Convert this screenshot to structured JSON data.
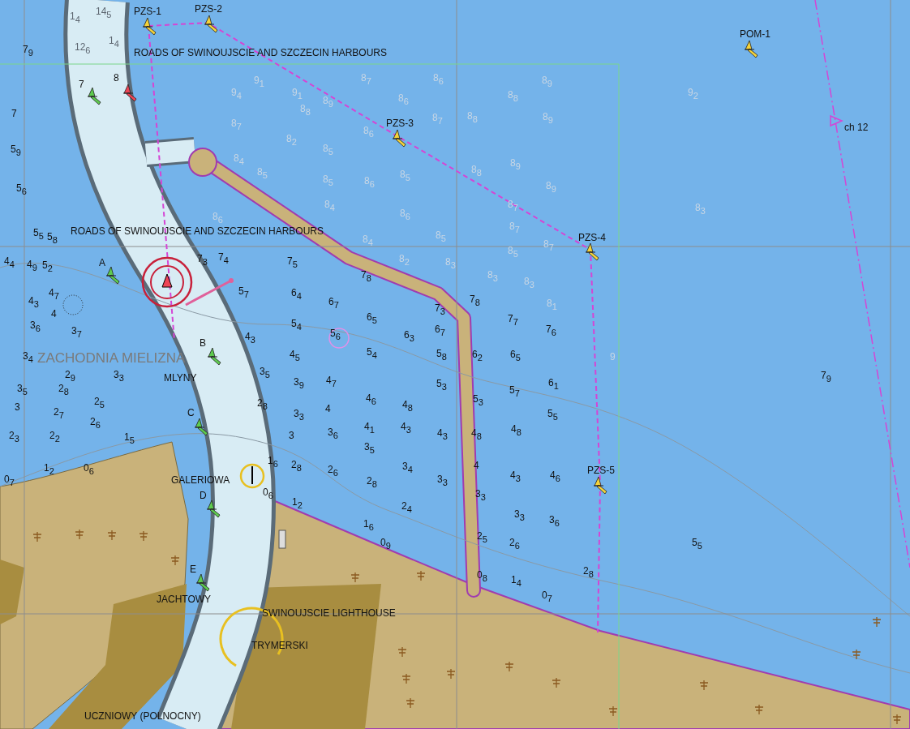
{
  "chart": {
    "area_labels": [
      {
        "text": "ROADS OF SWINOUJSCIE AND SZCZECIN HARBOURS",
        "kind": "zone"
      },
      {
        "text": "ROADS OF SWINOUJSCIE AND SZCZECIN HARBOURS",
        "kind": "zone"
      },
      {
        "text": "ZACHODNIA MIELIZNA",
        "kind": "shoal"
      },
      {
        "text": "MLYNY",
        "kind": "place"
      },
      {
        "text": "GALERIOWA",
        "kind": "place"
      },
      {
        "text": "JACHTOWY",
        "kind": "place"
      },
      {
        "text": "SWINOUJSCIE LIGHTHOUSE",
        "kind": "place"
      },
      {
        "text": "TRYMERSKI",
        "kind": "place"
      },
      {
        "text": "UCZNIOWY (POLNOCNY)",
        "kind": "place"
      },
      {
        "text": "ch 12",
        "kind": "place"
      }
    ],
    "buoys": [
      {
        "label": "PZS-1",
        "kind": "special"
      },
      {
        "label": "PZS-2",
        "kind": "special"
      },
      {
        "label": "POM-1",
        "kind": "special"
      },
      {
        "label": "PZS-3",
        "kind": "special"
      },
      {
        "label": "PZS-4",
        "kind": "special"
      },
      {
        "label": "PZS-5",
        "kind": "special"
      },
      {
        "label": "7",
        "kind": "starboard"
      },
      {
        "label": "8",
        "kind": "port"
      },
      {
        "label": "A",
        "kind": "starboard"
      },
      {
        "label": "B",
        "kind": "starboard"
      },
      {
        "label": "C",
        "kind": "starboard"
      },
      {
        "label": "D",
        "kind": "starboard"
      },
      {
        "label": "E",
        "kind": "starboard"
      }
    ],
    "soundings": [
      {
        "depth": "6$_{4}$",
        "kind": "shallow"
      },
      {
        "depth": "6$_{7}$",
        "kind": "shallow"
      },
      {
        "depth": "6$_{5}$",
        "kind": "shallow"
      },
      {
        "depth": "5$_{4}$",
        "kind": "shallow"
      },
      {
        "depth": "5$_{6}$",
        "kind": "shallow"
      },
      {
        "depth": "6$_{3}$",
        "kind": "shallow"
      },
      {
        "depth": "5$_{4}$",
        "kind": "shallow"
      },
      {
        "depth": "4$_{3}$",
        "kind": "shallow"
      },
      {
        "depth": "4$_{5}$",
        "kind": "shallow"
      },
      {
        "depth": "3$_{5}$",
        "kind": "shallow"
      },
      {
        "depth": "3$_{9}$",
        "kind": "shallow"
      },
      {
        "depth": "4$_{7}$",
        "kind": "shallow"
      },
      {
        "depth": "7$_{3}$",
        "kind": "shallow"
      },
      {
        "depth": "6$_{7}$",
        "kind": "shallow"
      },
      {
        "depth": "5$_{8}$",
        "kind": "shallow"
      },
      {
        "depth": "5$_{3}$",
        "kind": "shallow"
      },
      {
        "depth": "7$_{8}$",
        "kind": "shallow"
      },
      {
        "depth": "7$_{7}$",
        "kind": "shallow"
      },
      {
        "depth": "7$_{6}$",
        "kind": "shallow"
      },
      {
        "depth": "6$_{2}$",
        "kind": "shallow"
      },
      {
        "depth": "6$_{5}$",
        "kind": "shallow"
      },
      {
        "depth": "6$_{1}$",
        "kind": "shallow"
      },
      {
        "depth": "5$_{7}$",
        "kind": "shallow"
      },
      {
        "depth": "2$_{8}$",
        "kind": "shallow"
      },
      {
        "depth": "3$_{3}$",
        "kind": "shallow"
      },
      {
        "depth": "4",
        "kind": "shallow"
      },
      {
        "depth": "4$_{6}$",
        "kind": "shallow"
      },
      {
        "depth": "4$_{8}$",
        "kind": "shallow"
      },
      {
        "depth": "5$_{3}$",
        "kind": "shallow"
      },
      {
        "depth": "4$_{1}$",
        "kind": "shallow"
      },
      {
        "depth": "4$_{3}$",
        "kind": "shallow"
      },
      {
        "depth": "4$_{3}$",
        "kind": "shallow"
      },
      {
        "depth": "4$_{8}$",
        "kind": "shallow"
      },
      {
        "depth": "4$_{8}$",
        "kind": "shallow"
      },
      {
        "depth": "5$_{5}$",
        "kind": "shallow"
      },
      {
        "depth": "3",
        "kind": "shallow"
      },
      {
        "depth": "3$_{6}$",
        "kind": "shallow"
      },
      {
        "depth": "3$_{5}$",
        "kind": "shallow"
      },
      {
        "depth": "3$_{4}$",
        "kind": "shallow"
      },
      {
        "depth": "3$_{3}$",
        "kind": "shallow"
      },
      {
        "depth": "4",
        "kind": "shallow"
      },
      {
        "depth": "4$_{3}$",
        "kind": "shallow"
      },
      {
        "depth": "4$_{6}$",
        "kind": "shallow"
      },
      {
        "depth": "1$_{6}$",
        "kind": "shallow"
      },
      {
        "depth": "2$_{8}$",
        "kind": "shallow"
      },
      {
        "depth": "2$_{6}$",
        "kind": "shallow"
      },
      {
        "depth": "2$_{8}$",
        "kind": "shallow"
      },
      {
        "depth": "2$_{4}$",
        "kind": "shallow"
      },
      {
        "depth": "3$_{3}$",
        "kind": "shallow"
      },
      {
        "depth": "3$_{3}$",
        "kind": "shallow"
      },
      {
        "depth": "3$_{6}$",
        "kind": "shallow"
      },
      {
        "depth": "0$_{6}$",
        "kind": "shallow"
      },
      {
        "depth": "1$_{2}$",
        "kind": "shallow"
      },
      {
        "depth": "1$_{6}$",
        "kind": "shallow"
      },
      {
        "depth": "0$_{9}$",
        "kind": "shallow"
      },
      {
        "depth": "2$_{5}$",
        "kind": "shallow"
      },
      {
        "depth": "2$_{6}$",
        "kind": "shallow"
      },
      {
        "depth": "2$_{8}$",
        "kind": "shallow"
      },
      {
        "depth": "0$_{8}$",
        "kind": "shallow"
      },
      {
        "depth": "1$_{4}$",
        "kind": "shallow"
      },
      {
        "depth": "0$_{7}$",
        "kind": "shallow"
      },
      {
        "depth": "5$_{5}$",
        "kind": "shallow"
      },
      {
        "depth": "7$_{9}$",
        "kind": "shallow"
      },
      {
        "depth": "7$_{3}$",
        "kind": "shallow"
      },
      {
        "depth": "7$_{4}$",
        "kind": "shallow"
      },
      {
        "depth": "7$_{5}$",
        "kind": "shallow"
      },
      {
        "depth": "5$_{7}$",
        "kind": "shallow"
      },
      {
        "depth": "7$_{8}$",
        "kind": "shallow"
      },
      {
        "depth": "7$_{9}$",
        "kind": "shallow"
      },
      {
        "depth": "7",
        "kind": "shallow"
      },
      {
        "depth": "5$_{9}$",
        "kind": "shallow"
      },
      {
        "depth": "5$_{6}$",
        "kind": "shallow"
      },
      {
        "depth": "5$_{5}$",
        "kind": "shallow"
      },
      {
        "depth": "5$_{8}$",
        "kind": "shallow"
      },
      {
        "depth": "4$_{4}$",
        "kind": "shallow"
      },
      {
        "depth": "4$_{9}$",
        "kind": "shallow"
      },
      {
        "depth": "5$_{2}$",
        "kind": "shallow"
      },
      {
        "depth": "4$_{3}$",
        "kind": "shallow"
      },
      {
        "depth": "3$_{6}$",
        "kind": "shallow"
      },
      {
        "depth": "3$_{4}$",
        "kind": "shallow"
      },
      {
        "depth": "2$_{9}$",
        "kind": "shallow"
      },
      {
        "depth": "3$_{5}$",
        "kind": "shallow"
      },
      {
        "depth": "2$_{8}$",
        "kind": "shallow"
      },
      {
        "depth": "3",
        "kind": "shallow"
      },
      {
        "depth": "2$_{7}$",
        "kind": "shallow"
      },
      {
        "depth": "2$_{5}$",
        "kind": "shallow"
      },
      {
        "depth": "2$_{6}$",
        "kind": "shallow"
      },
      {
        "depth": "2$_{3}$",
        "kind": "shallow"
      },
      {
        "depth": "2$_{2}$",
        "kind": "shallow"
      },
      {
        "depth": "1$_{5}$",
        "kind": "shallow"
      },
      {
        "depth": "1$_{2}$",
        "kind": "shallow"
      },
      {
        "depth": "0$_{6}$",
        "kind": "shallow"
      },
      {
        "depth": "0$_{7}$",
        "kind": "shallow"
      },
      {
        "depth": "4$_{7}$",
        "kind": "shallow"
      },
      {
        "depth": "4",
        "kind": "shallow"
      },
      {
        "depth": "3$_{7}$",
        "kind": "shallow"
      },
      {
        "depth": "3$_{3}$",
        "kind": "shallow"
      },
      {
        "depth": "8$_{7}$",
        "kind": "deep"
      },
      {
        "depth": "8$_{6}$",
        "kind": "deep"
      },
      {
        "depth": "8$_{9}$",
        "kind": "deep"
      },
      {
        "depth": "8$_{6}$",
        "kind": "deep"
      },
      {
        "depth": "8$_{8}$",
        "kind": "deep"
      },
      {
        "depth": "8$_{7}$",
        "kind": "deep"
      },
      {
        "depth": "8$_{8}$",
        "kind": "deep"
      },
      {
        "depth": "8$_{9}$",
        "kind": "deep"
      },
      {
        "depth": "8$_{6}$",
        "kind": "deep"
      },
      {
        "depth": "8$_{5}$",
        "kind": "deep"
      },
      {
        "depth": "8$_{5}$",
        "kind": "deep"
      },
      {
        "depth": "8$_{5}$",
        "kind": "deep"
      },
      {
        "depth": "8$_{6}$",
        "kind": "deep"
      },
      {
        "depth": "8$_{8}$",
        "kind": "deep"
      },
      {
        "depth": "8$_{9}$",
        "kind": "deep"
      },
      {
        "depth": "8$_{9}$",
        "kind": "deep"
      },
      {
        "depth": "8$_{4}$",
        "kind": "deep"
      },
      {
        "depth": "8$_{6}$",
        "kind": "deep"
      },
      {
        "depth": "8$_{7}$",
        "kind": "deep"
      },
      {
        "depth": "8$_{4}$",
        "kind": "deep"
      },
      {
        "depth": "8$_{5}$",
        "kind": "deep"
      },
      {
        "depth": "8$_{7}$",
        "kind": "deep"
      },
      {
        "depth": "8$_{2}$",
        "kind": "deep"
      },
      {
        "depth": "8$_{3}$",
        "kind": "deep"
      },
      {
        "depth": "8$_{3}$",
        "kind": "deep"
      },
      {
        "depth": "8$_{3}$",
        "kind": "deep"
      },
      {
        "depth": "8$_{1}$",
        "kind": "deep"
      },
      {
        "depth": "8$_{5}$",
        "kind": "deep"
      },
      {
        "depth": "8$_{7}$",
        "kind": "deep"
      },
      {
        "depth": "9$_{2}$",
        "kind": "deep"
      },
      {
        "depth": "8$_{3}$",
        "kind": "deep"
      },
      {
        "depth": "9",
        "kind": "deep"
      },
      {
        "depth": "9$_{1}$",
        "kind": "deep"
      },
      {
        "depth": "9$_{4}$",
        "kind": "deep"
      },
      {
        "depth": "9$_{1}$",
        "kind": "deep"
      },
      {
        "depth": "8$_{9}$",
        "kind": "deep"
      },
      {
        "depth": "8$_{7}$",
        "kind": "deep"
      },
      {
        "depth": "8$_{4}$",
        "kind": "deep"
      },
      {
        "depth": "8$_{5}$",
        "kind": "deep"
      },
      {
        "depth": "8$_{2}$",
        "kind": "deep"
      },
      {
        "depth": "8$_{6}$",
        "kind": "deep"
      },
      {
        "depth": "8$_{8}$",
        "kind": "deep"
      },
      {
        "depth": "1$_{4}$",
        "kind": "channel"
      },
      {
        "depth": "14$_{5}$",
        "kind": "channel"
      },
      {
        "depth": "12$_{6}$",
        "kind": "channel"
      },
      {
        "depth": "1$_{4}$",
        "kind": "channel"
      }
    ]
  }
}
